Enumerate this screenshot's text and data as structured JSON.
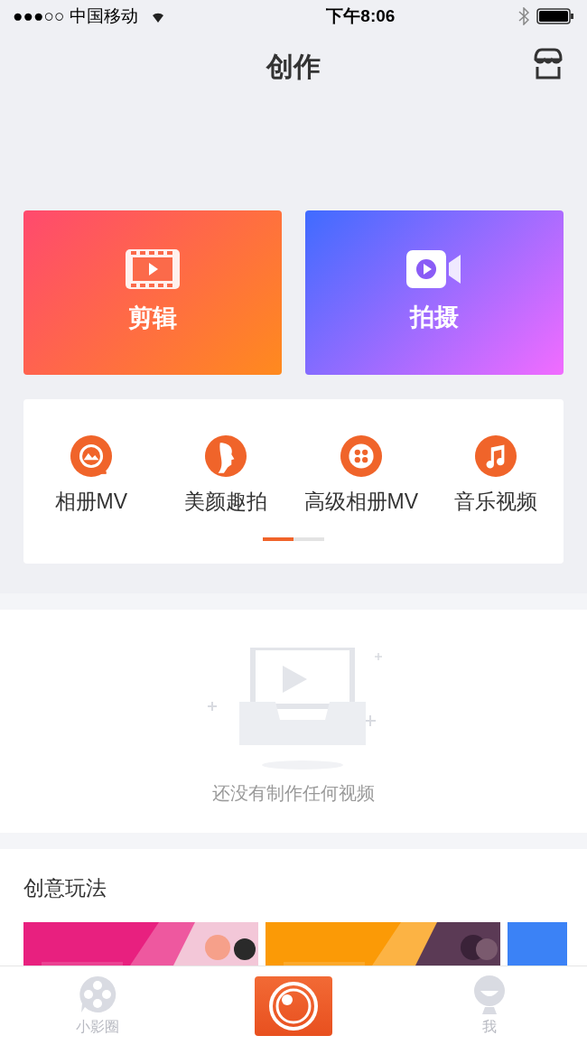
{
  "status_bar": {
    "carrier": "●●●○○ 中国移动",
    "time": "下午8:06"
  },
  "header": {
    "title": "创作"
  },
  "main_actions": [
    {
      "kind": "edit",
      "label": "剪辑"
    },
    {
      "kind": "shoot",
      "label": "拍摄"
    }
  ],
  "tools": [
    {
      "kind": "album",
      "label": "相册MV"
    },
    {
      "kind": "beauty",
      "label": "美颜趣拍"
    },
    {
      "kind": "reel",
      "label": "高级相册MV"
    },
    {
      "kind": "music",
      "label": "音乐视频"
    }
  ],
  "pager": [
    {
      "selected": true
    },
    {
      "selected": false
    }
  ],
  "empty_state": {
    "message": "还没有制作任何视频"
  },
  "creative": {
    "title": "创意玩法",
    "banners": [
      {
        "color": "#e8207f"
      },
      {
        "color": "#fb9a06"
      },
      {
        "color": "#3b82f6"
      }
    ]
  },
  "tab_bar": [
    {
      "kind": "circle",
      "label": "小影圈"
    },
    {
      "kind": "camera"
    },
    {
      "kind": "me",
      "label": "我"
    }
  ]
}
